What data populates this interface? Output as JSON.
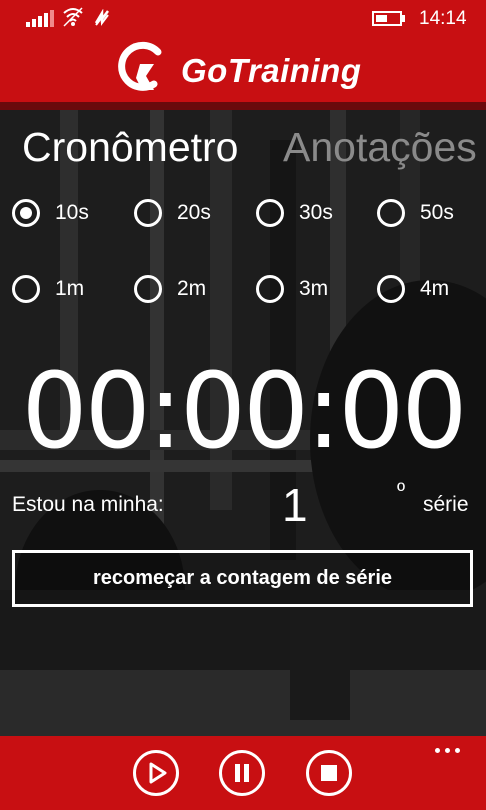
{
  "status_bar": {
    "time": "14:14",
    "icons": [
      "signal-icon",
      "wifi-icon",
      "data-sync-icon",
      "battery-icon"
    ]
  },
  "header": {
    "app_name": "GoTraining",
    "brand_color": "#c80f12",
    "logo_icon": "helmet-logo-icon"
  },
  "tabs": [
    {
      "label": "Cronômetro",
      "active": true
    },
    {
      "label": "Anotações",
      "active": false
    }
  ],
  "intervals": {
    "row1": [
      {
        "label": "10s",
        "selected": true
      },
      {
        "label": "20s",
        "selected": false
      },
      {
        "label": "30s",
        "selected": false
      },
      {
        "label": "50s",
        "selected": false
      }
    ],
    "row2": [
      {
        "label": "1m",
        "selected": false
      },
      {
        "label": "2m",
        "selected": false
      },
      {
        "label": "3m",
        "selected": false
      },
      {
        "label": "4m",
        "selected": false
      }
    ]
  },
  "timer": {
    "display": "00:00:00"
  },
  "series": {
    "prefix": "Estou na minha:",
    "number": "1",
    "degree": "º",
    "suffix": "série"
  },
  "reset_button": {
    "label": "recomeçar a contagem de série"
  },
  "app_bar": {
    "buttons": [
      "play-icon",
      "pause-icon",
      "stop-icon"
    ],
    "more": "more-options-icon"
  }
}
